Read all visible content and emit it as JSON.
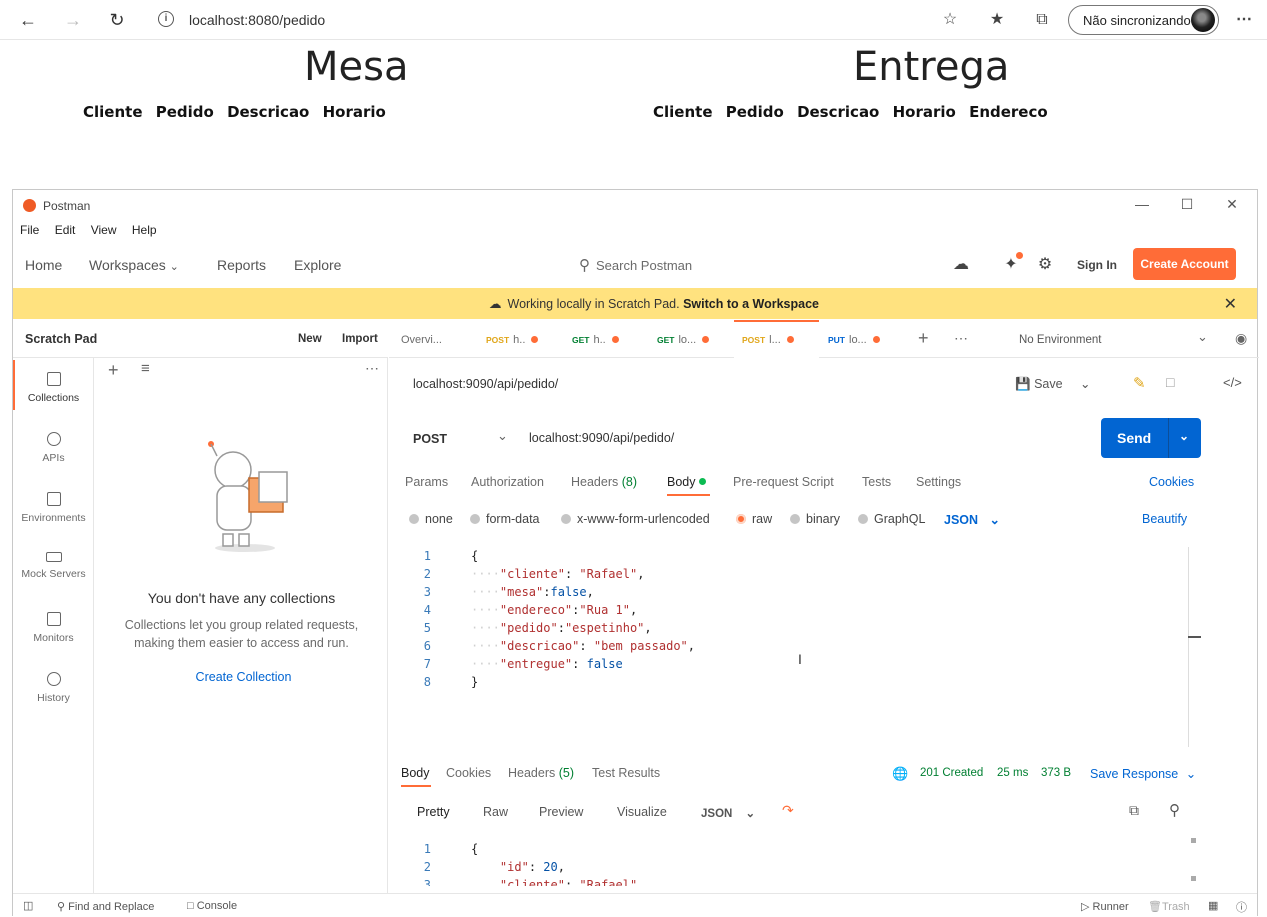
{
  "browser": {
    "url": "localhost:8080/pedido",
    "sync_label": "Não sincronizando"
  },
  "page": {
    "mesa": {
      "title": "Mesa",
      "columns": [
        "Cliente",
        "Pedido",
        "Descricao",
        "Horario"
      ]
    },
    "entrega": {
      "title": "Entrega",
      "columns": [
        "Cliente",
        "Pedido",
        "Descricao",
        "Horario",
        "Endereco"
      ]
    }
  },
  "postman": {
    "window_title": "Postman",
    "menu": [
      "File",
      "Edit",
      "View",
      "Help"
    ],
    "nav": {
      "home": "Home",
      "workspaces": "Workspaces",
      "reports": "Reports",
      "explore": "Explore"
    },
    "search_placeholder": "Search Postman",
    "sign_in": "Sign In",
    "create_account": "Create Account",
    "banner": {
      "text": "Working locally in Scratch Pad.",
      "link": "Switch to a Workspace"
    },
    "sidebar": {
      "title": "Scratch Pad",
      "new": "New",
      "import": "Import",
      "rail": [
        "Collections",
        "APIs",
        "Environments",
        "Mock Servers",
        "Monitors",
        "History"
      ],
      "empty_title": "You don't have any collections",
      "empty_desc_1": "Collections let you group related requests,",
      "empty_desc_2": "making them easier to access and run.",
      "create_collection": "Create Collection"
    },
    "tabs": [
      {
        "method": "",
        "label": "Overvi..."
      },
      {
        "method": "POST",
        "label": "h.."
      },
      {
        "method": "GET",
        "label": "h.."
      },
      {
        "method": "GET",
        "label": "lo..."
      },
      {
        "method": "POST",
        "label": "l..."
      },
      {
        "method": "PUT",
        "label": "lo..."
      }
    ],
    "environment": "No Environment",
    "request": {
      "name": "localhost:9090/api/pedido/",
      "save": "Save",
      "method": "POST",
      "url": "localhost:9090/api/pedido/",
      "send": "Send",
      "tabs": {
        "params": "Params",
        "authorization": "Authorization",
        "headers": "Headers",
        "headers_count": "(8)",
        "body": "Body",
        "pre_request": "Pre-request Script",
        "tests": "Tests",
        "settings": "Settings",
        "cookies": "Cookies"
      },
      "body_types": [
        "none",
        "form-data",
        "x-www-form-urlencoded",
        "raw",
        "binary",
        "GraphQL"
      ],
      "body_format": "JSON",
      "beautify": "Beautify",
      "body_lines": [
        {
          "n": "1",
          "text": "{"
        },
        {
          "n": "2",
          "key": "\"cliente\"",
          "sep": ": ",
          "val": "\"Rafael\"",
          "end": ","
        },
        {
          "n": "3",
          "key": "\"mesa\"",
          "sep": ":",
          "val": "false",
          "end": ","
        },
        {
          "n": "4",
          "key": "\"endereco\"",
          "sep": ":",
          "val": "\"Rua 1\"",
          "end": ","
        },
        {
          "n": "5",
          "key": "\"pedido\"",
          "sep": ":",
          "val": "\"espetinho\"",
          "end": ","
        },
        {
          "n": "6",
          "key": "\"descricao\"",
          "sep": ": ",
          "val": "\"bem passado\"",
          "end": ","
        },
        {
          "n": "7",
          "key": "\"entregue\"",
          "sep": ": ",
          "val": "false",
          "end": ""
        },
        {
          "n": "8",
          "text": "}"
        }
      ]
    },
    "response": {
      "tabs": {
        "body": "Body",
        "cookies": "Cookies",
        "headers": "Headers",
        "headers_count": "(5)",
        "test_results": "Test Results"
      },
      "status": "201 Created",
      "time": "25 ms",
      "size": "373 B",
      "save_response": "Save Response",
      "views": [
        "Pretty",
        "Raw",
        "Preview",
        "Visualize"
      ],
      "format": "JSON",
      "lines": [
        {
          "n": "1",
          "text": "{"
        },
        {
          "n": "2",
          "key": "\"id\"",
          "val": "20"
        },
        {
          "n": "3",
          "key": "\"cliente\"",
          "val": "\"Rafael\""
        }
      ]
    },
    "status_bar": {
      "find_replace": "Find and Replace",
      "console": "Console",
      "runner": "Runner",
      "trash": "Trash"
    }
  },
  "colors": {
    "accent": "#ff6c37",
    "send": "#0265d2",
    "banner": "#ffe27f",
    "link": "#0265d2",
    "status_ok": "#007f31"
  }
}
